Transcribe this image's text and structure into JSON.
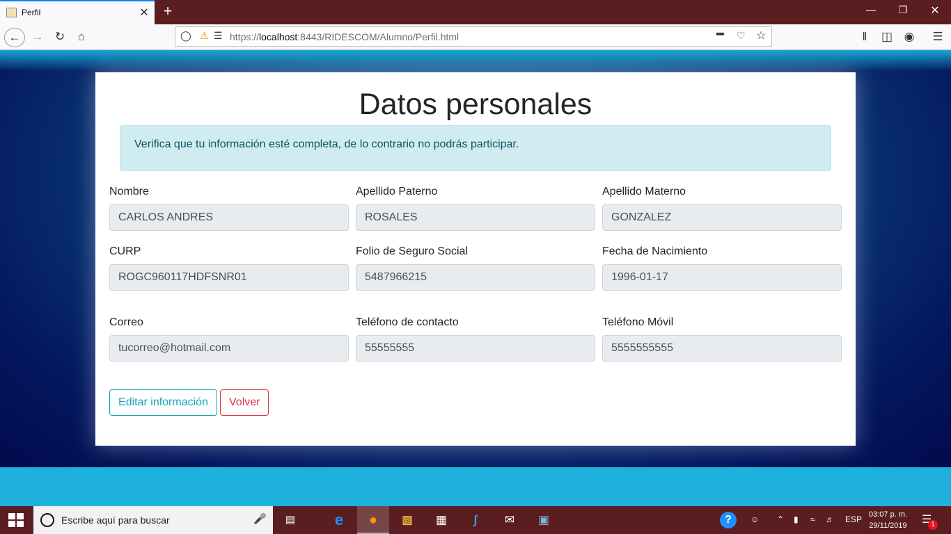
{
  "browser": {
    "tab_title": "Perfil",
    "tab_close": "✕",
    "new_tab": "+",
    "url_host": "https://localhost",
    "url_rest": ":8443/RIDESCOM/Alumno/Perfil.html",
    "url_more": "•••"
  },
  "page": {
    "heading": "Datos personales",
    "alert": "Verifica que tu información esté completa, de lo contrario no podrás participar.",
    "fields": [
      {
        "label": "Nombre",
        "value": "CARLOS ANDRES"
      },
      {
        "label": "Apellido Paterno",
        "value": "ROSALES"
      },
      {
        "label": "Apellido Materno",
        "value": "GONZALEZ"
      },
      {
        "label": "CURP",
        "value": "ROGC960117HDFSNR01"
      },
      {
        "label": "Folio de Seguro Social",
        "value": "5487966215"
      },
      {
        "label": "Fecha de Nacimiento",
        "value": "1996-01-17"
      },
      {
        "label": "Correo",
        "value": "tucorreo@hotmail.com"
      },
      {
        "label": "Teléfono de contacto",
        "value": "55555555"
      },
      {
        "label": "Teléfono Móvil",
        "value": "5555555555"
      }
    ],
    "edit_button": "Editar información",
    "back_button": "Volver"
  },
  "taskbar": {
    "search_placeholder": "Escribe aquí para buscar",
    "language": "ESP",
    "time": "03:07 p. m.",
    "date": "29/11/2019",
    "notification_count": "1"
  },
  "icons": {
    "back": "back-arrow-icon",
    "forward": "forward-arrow-icon",
    "reload": "reload-icon",
    "home": "home-icon"
  },
  "colors": {
    "accent_info": "#17a2b8",
    "accent_danger": "#dc3545",
    "alert_bg": "#d1ecf1",
    "window_frame": "#5a1d20"
  }
}
